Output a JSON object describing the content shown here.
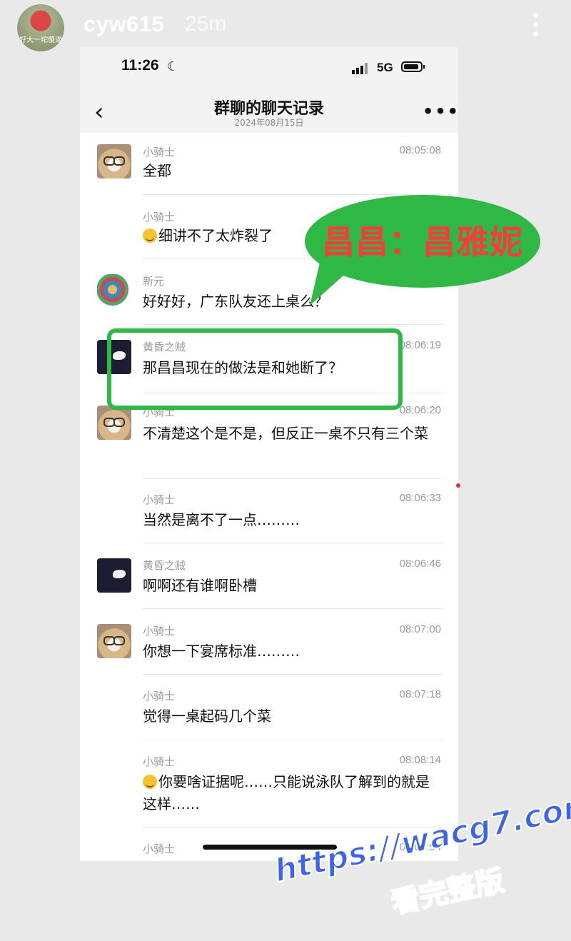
{
  "story": {
    "username": "cyw615",
    "age": "25m",
    "avatar_caption": "好大一坨傻逼"
  },
  "status_bar": {
    "time": "11:26",
    "network": "5G"
  },
  "nav": {
    "back": "‹",
    "title": "群聊的聊天记录",
    "subtitle": "2024年08月15日",
    "more": "•••"
  },
  "messages": [
    {
      "sender": "小骑士",
      "time": "08:05:08",
      "text": "全都",
      "avatar": "dog"
    },
    {
      "sender": "小骑士",
      "time": "",
      "text": "细讲不了太炸裂了",
      "emoji": "laughing-crying-emoji"
    },
    {
      "sender": "新元",
      "time": "",
      "text": "好好好，广东队友还上桌么？",
      "avatar": "bird"
    },
    {
      "sender": "黄昏之贼",
      "time": "08:06:19",
      "text": "那昌昌现在的做法是和她断了？",
      "avatar": "dark"
    },
    {
      "sender": "小骑士",
      "time": "08:06:20",
      "text": "不清楚这个是不是，但反正一桌不只有三个菜",
      "avatar": "dog"
    },
    {
      "sender": "小骑士",
      "time": "08:06:33",
      "text": "当然是离不了一点………"
    },
    {
      "sender": "黄昏之贼",
      "time": "08:06:46",
      "text": "啊啊还有谁啊卧槽",
      "avatar": "dark"
    },
    {
      "sender": "小骑士",
      "time": "08:07:00",
      "text": "你想一下宴席标准………",
      "avatar": "dog"
    },
    {
      "sender": "小骑士",
      "time": "08:07:18",
      "text": "觉得一桌起码几个菜"
    },
    {
      "sender": "小骑士",
      "time": "08:08:14",
      "text": "你要啥证据呢……只能说泳队了解到的就是这样……",
      "emoji": "laughing-crying-emoji"
    },
    {
      "sender": "小骑士",
      "time": "08:08:54",
      "text": ""
    }
  ],
  "annotation": {
    "callout_text": "昌昌：昌雅妮",
    "color": "#2fb845",
    "text_color": "#f53d3d"
  },
  "watermark": {
    "line1": "https://wacg7.com",
    "line2": "看完整版"
  }
}
